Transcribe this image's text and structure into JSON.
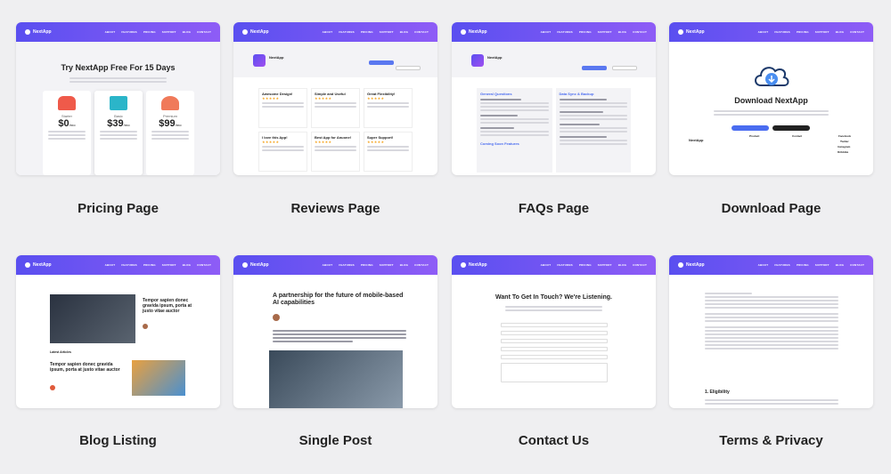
{
  "navbar": {
    "brand": "NextApp",
    "links": [
      "ABOUT",
      "FEATURES",
      "PRICING",
      "SUPPORT",
      "BLOG",
      "CONTACT"
    ]
  },
  "cards": [
    {
      "label": "Pricing Page",
      "headline": "Try NextApp Free For 15 Days",
      "plans": [
        {
          "name": "Starter",
          "price": "0"
        },
        {
          "name": "Basic",
          "price": "39"
        },
        {
          "name": "Premium",
          "price": "99"
        }
      ],
      "price_unit": "/mo"
    },
    {
      "label": "Reviews Page",
      "app_name": "NextApp",
      "reviews": [
        "Awesome Design!",
        "Simple and Useful",
        "Great Flexibility!",
        "I love this App!",
        "Best App for Anuone!",
        "Super Support!"
      ]
    },
    {
      "label": "FAQs Page",
      "app_name": "NextApp",
      "faq_sections": [
        "General Questions",
        "Data Sync & Backup",
        "Coming Soon Features"
      ]
    },
    {
      "label": "Download Page",
      "headline": "Download NextApp",
      "footer_cols": [
        "Product",
        "Contact",
        "Facebook",
        "Twitter",
        "Instagram",
        "Dribbble"
      ]
    },
    {
      "label": "Blog Listing",
      "post_title": "Tempor sapien donec gravida ipsum, porta at justo vitae auctor",
      "section": "Latest Articles",
      "post2_title": "Tempor sapien donec gravida ipsum, porta at justo vitae auctor"
    },
    {
      "label": "Single Post",
      "post_title": "A partnership for the future of mobile-based AI capabilities"
    },
    {
      "label": "Contact Us",
      "headline": "Want To Get In Touch? We're Listening."
    },
    {
      "label": "Terms & Privacy",
      "section": "1. Eligibility"
    }
  ]
}
